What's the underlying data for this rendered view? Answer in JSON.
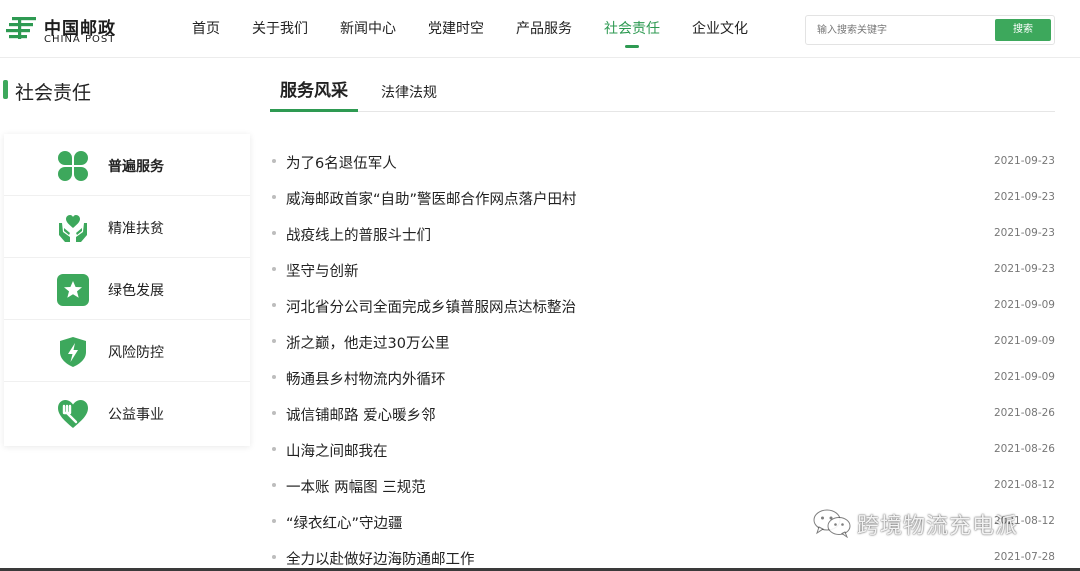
{
  "logo": {
    "cn": "中国邮政",
    "en": "CHINA POST"
  },
  "nav": {
    "items": [
      {
        "label": "首页"
      },
      {
        "label": "关于我们"
      },
      {
        "label": "新闻中心"
      },
      {
        "label": "党建时空"
      },
      {
        "label": "产品服务"
      },
      {
        "label": "社会责任",
        "active": true
      },
      {
        "label": "企业文化"
      }
    ]
  },
  "search": {
    "placeholder": "输入搜索关键字",
    "button_label": "搜索"
  },
  "sidebar": {
    "title": "社会责任",
    "items": [
      {
        "label": "普遍服务",
        "icon": "clover-icon",
        "active": true
      },
      {
        "label": "精准扶贫",
        "icon": "hands-heart-icon"
      },
      {
        "label": "绿色发展",
        "icon": "star-square-icon"
      },
      {
        "label": "风险防控",
        "icon": "shield-bolt-icon"
      },
      {
        "label": "公益事业",
        "icon": "heart-fork-icon"
      }
    ]
  },
  "tabs": [
    {
      "label": "服务风采",
      "active": true
    },
    {
      "label": "法律法规"
    }
  ],
  "news": [
    {
      "title": "为了6名退伍军人",
      "date": "2021-09-23"
    },
    {
      "title": "威海邮政首家“自助”警医邮合作网点落户田村",
      "date": "2021-09-23"
    },
    {
      "title": "战疫线上的普服斗士们",
      "date": "2021-09-23"
    },
    {
      "title": "坚守与创新",
      "date": "2021-09-23"
    },
    {
      "title": "河北省分公司全面完成乡镇普服网点达标整治",
      "date": "2021-09-09"
    },
    {
      "title": "浙之巅，他走过30万公里",
      "date": "2021-09-09"
    },
    {
      "title": "畅通县乡村物流内外循环",
      "date": "2021-09-09"
    },
    {
      "title": "诚信铺邮路 爱心暖乡邻",
      "date": "2021-08-26"
    },
    {
      "title": "山海之间邮我在",
      "date": "2021-08-26"
    },
    {
      "title": "一本账 两幅图 三规范",
      "date": "2021-08-12"
    },
    {
      "title": "“绿衣红心”守边疆",
      "date": "2021-08-12"
    },
    {
      "title": "全力以赴做好边海防通邮工作",
      "date": "2021-07-28"
    }
  ],
  "watermark": {
    "text": "跨境物流充电派",
    "icon": "wechat-icon"
  },
  "colors": {
    "accent": "#3da85c",
    "accent_dark": "#2e9a52",
    "text": "#222222",
    "date": "#777777"
  }
}
